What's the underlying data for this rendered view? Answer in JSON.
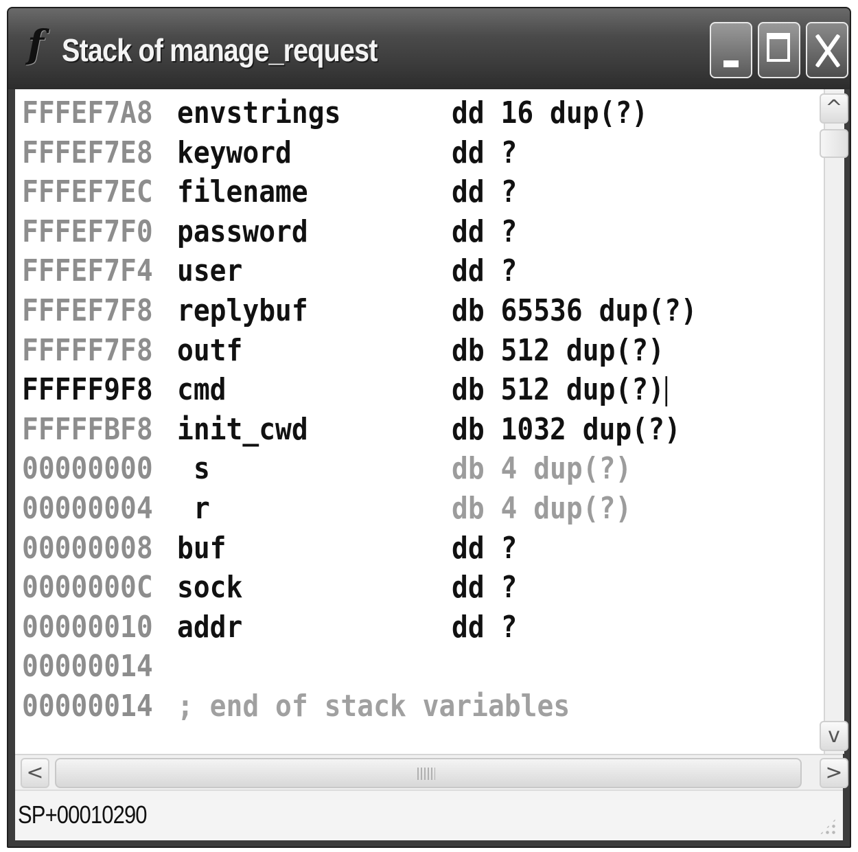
{
  "window": {
    "title": "Stack of manage_request",
    "icon_glyph": "f",
    "icon": "ida-function-icon"
  },
  "listing": {
    "rows": [
      {
        "address": "FFFEF7A8",
        "name": "envstrings",
        "decl": "dd 16 dup(?)",
        "style": "normal"
      },
      {
        "address": "FFFEF7E8",
        "name": "keyword",
        "decl": "dd ?",
        "style": "normal"
      },
      {
        "address": "FFFEF7EC",
        "name": "filename",
        "decl": "dd ?",
        "style": "normal"
      },
      {
        "address": "FFFEF7F0",
        "name": "password",
        "decl": "dd ?",
        "style": "normal"
      },
      {
        "address": "FFFEF7F4",
        "name": "user",
        "decl": "dd ?",
        "style": "normal"
      },
      {
        "address": "FFFEF7F8",
        "name": "replybuf",
        "decl": "db 65536 dup(?)",
        "style": "normal"
      },
      {
        "address": "FFFFF7F8",
        "name": "outf",
        "decl": "db 512 dup(?)",
        "style": "normal"
      },
      {
        "address": "FFFFF9F8",
        "name": "cmd",
        "decl": "db 512 dup(?)",
        "style": "current"
      },
      {
        "address": "FFFFFBF8",
        "name": "init_cwd",
        "decl": "db 1032 dup(?)",
        "style": "normal"
      },
      {
        "address": "00000000",
        "name": "s",
        "decl": "db 4 dup(?)",
        "style": "special"
      },
      {
        "address": "00000004",
        "name": "r",
        "decl": "db 4 dup(?)",
        "style": "special"
      },
      {
        "address": "00000008",
        "name": "buf",
        "decl": "dd ?",
        "style": "normal"
      },
      {
        "address": "0000000C",
        "name": "sock",
        "decl": "dd ?",
        "style": "normal"
      },
      {
        "address": "00000010",
        "name": "addr",
        "decl": "dd ?",
        "style": "normal"
      },
      {
        "address": "00000014",
        "name": "",
        "decl": "",
        "style": "normal"
      },
      {
        "address": "00000014",
        "name": "",
        "decl": "",
        "comment": "; end of stack variables",
        "style": "comment"
      }
    ]
  },
  "status": {
    "text": "SP+00010290"
  },
  "scroll": {
    "up_arrow": "^",
    "down_arrow": "v",
    "left_arrow": "<",
    "right_arrow": ">"
  }
}
